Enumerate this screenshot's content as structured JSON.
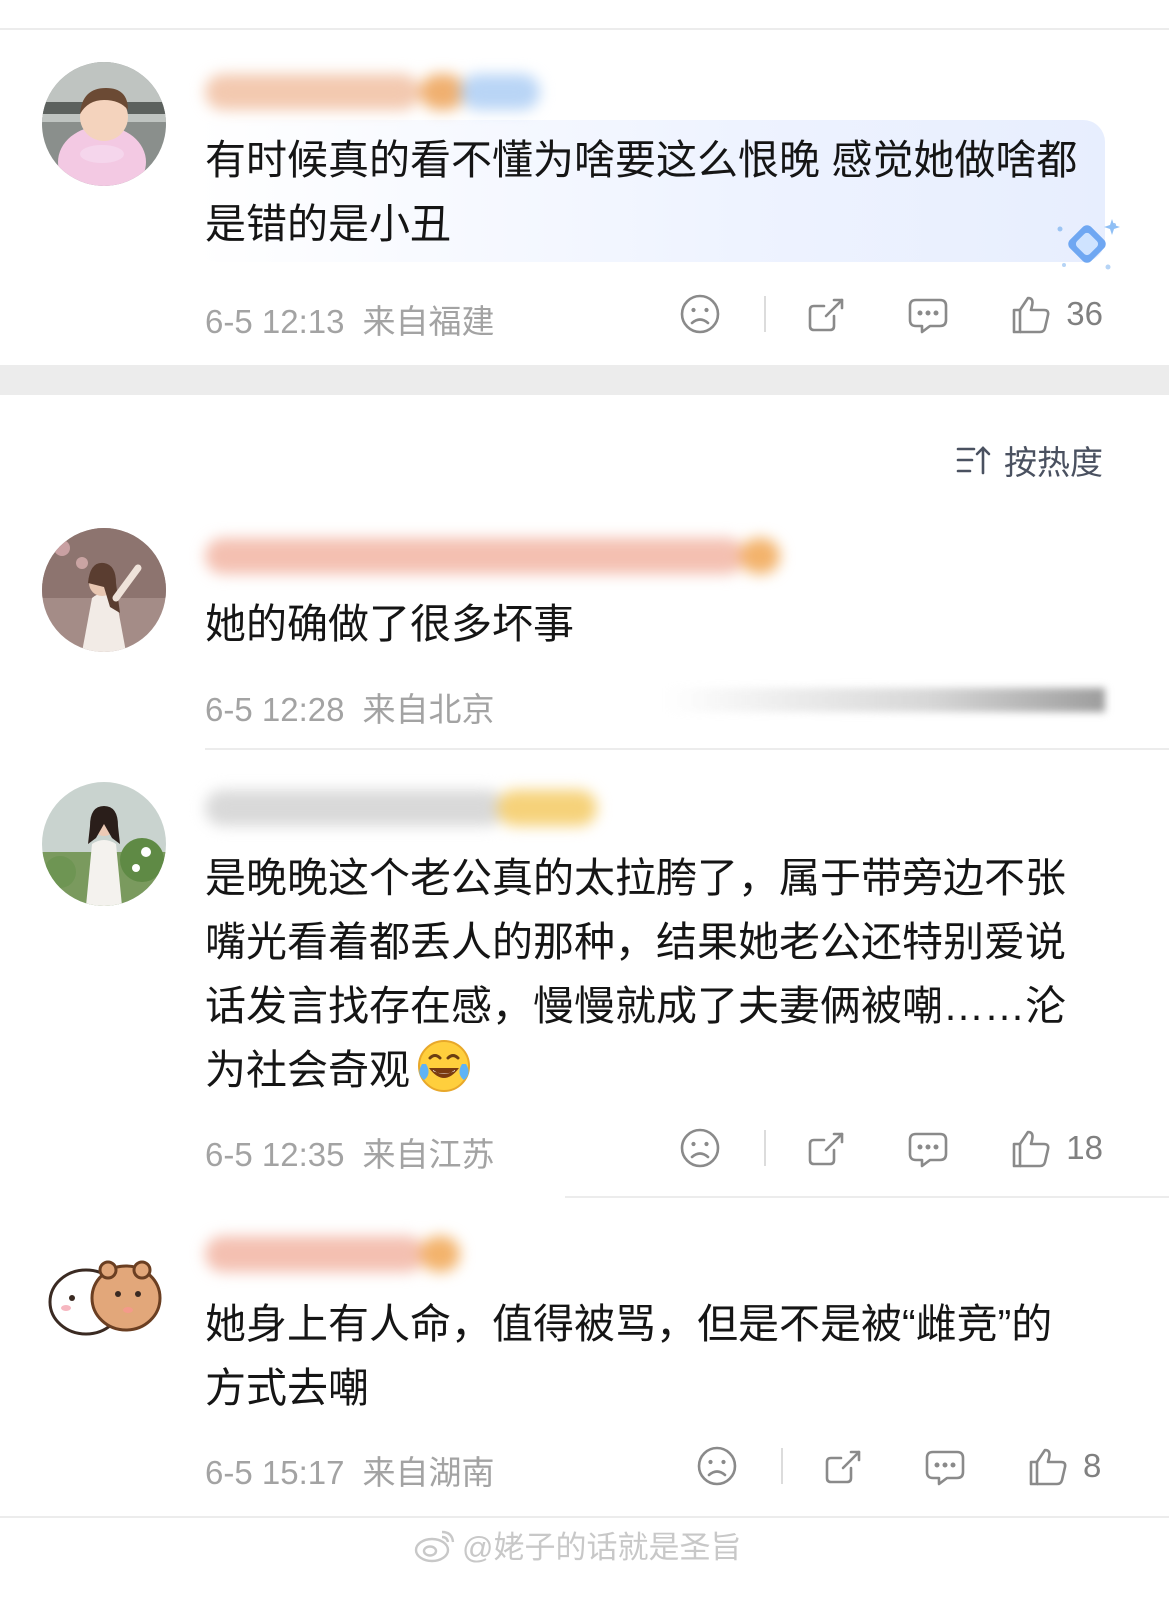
{
  "sort": {
    "label": "按热度",
    "icon": "sort-desc-icon"
  },
  "comments": [
    {
      "text": "有时候真的看不懂为啥要这么恨晚 感觉她做啥都是错的是小丑",
      "time": "6-5 12:13",
      "location": "来自福建",
      "likes": "36",
      "highlighted": true
    },
    {
      "text": "她的确做了很多坏事",
      "time": "6-5 12:28",
      "location": "来自北京",
      "likes": ""
    },
    {
      "text": "是晚晚这个老公真的太拉胯了，属于带旁边不张嘴光看着都丢人的那种，结果她老公还特别爱说话发言找存在感，慢慢就成了夫妻俩被嘲……沦为社会奇观",
      "emoji": "laughing-tears-emoji",
      "time": "6-5 12:35",
      "location": "来自江苏",
      "likes": "18"
    },
    {
      "text": "她身上有人命，值得被骂，但是不是被“雌竞”的方式去嘲",
      "time": "6-5 15:17",
      "location": "来自湖南",
      "likes": "8"
    }
  ],
  "watermark": "@姥子的话就是圣旨",
  "colors": {
    "meta": "#a3a3a3",
    "separator": "#ececec",
    "highlight": "#eef3ff"
  }
}
